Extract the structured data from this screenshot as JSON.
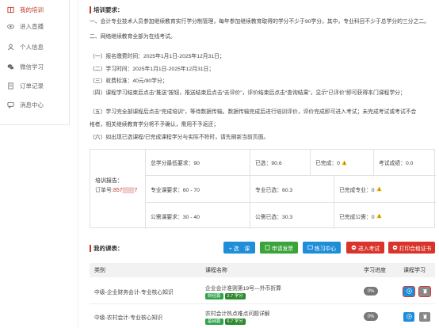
{
  "sidebar": {
    "items": [
      {
        "label": "我的培训",
        "icon": "book-icon",
        "active": true
      },
      {
        "label": "进入直播",
        "icon": "eye-icon",
        "active": false
      },
      {
        "label": "个人信息",
        "icon": "user-icon",
        "active": false
      },
      {
        "label": "微信学习",
        "icon": "wechat-icon",
        "active": false
      },
      {
        "label": "订单记录",
        "icon": "document-icon",
        "active": false
      },
      {
        "label": "消息中心",
        "icon": "message-icon",
        "active": false
      }
    ]
  },
  "requirements": {
    "title": "培训要求：",
    "lines": [
      "一、会计专业技术人员参加继续教育实行学分制管理，每年参加继续教育取得的学分不少于90学分，其中，专业科目不少于总学分的三分之二。",
      "二、网络继续教育全部为在线考试。",
      "（一）报名缴费时间：2025年1月1日-2025年12月31日；",
      "（二）学习时间：2025年1月1日-2025年12月31日；",
      "（三）收费标准：40元/90学分；",
      "（四）课程学习结束后点击“推送”按钮，推送结束后点击“去评价”，评价结束后点击“查询结果”，显示“已评价”即可获得本门课程学分；",
      "（五）学习完全部课程后点击“完成培训”，等待数据传输。数据传输完成后进行培训评价，评价完成即可进入考试；未完成考试或考试不合",
      "格者，相关继续教育学分将不予确认，需用不予返还；",
      "（六）如出现已选课程/已完成课程学分与实际不符时，请先刷新当前页面。"
    ]
  },
  "report": {
    "label": "培训报告：",
    "order_label": "订单号:",
    "order_value": "857▒▒▒7",
    "rows": [
      {
        "c1": "总学分最低要求：90",
        "c2": "已选：90.6",
        "c3": "已完成：0",
        "c4": "考试成绩：0.0"
      },
      {
        "c1": "专业课要求：60 - 70",
        "c2": "专业已选：60.3",
        "c3": "已完成专业：0"
      },
      {
        "c1": "公需课要求：30 - 40",
        "c2": "公需已选：30.3",
        "c3": "已完成公需：0"
      }
    ]
  },
  "courses": {
    "title": "我的课表：",
    "buttons": [
      {
        "label": "+ 选　课",
        "color": "#1f8ed8"
      },
      {
        "label": "申请发票",
        "color": "#3aa33a"
      },
      {
        "label": "练习中心",
        "color": "#1f8ed8"
      },
      {
        "label": "进入考试",
        "color": "#d9342b"
      },
      {
        "label": "打印合格证书",
        "color": "#d9342b"
      }
    ],
    "headers": [
      "类别",
      "课程名称",
      "学习进度",
      "课程学习"
    ],
    "rows": [
      {
        "category": "中级-企业财务会计-专业核心知识",
        "name": "企业会计准则第19号—外币折算",
        "tags": [
          {
            "text": "财经篇",
            "color": "#2fa34a"
          },
          {
            "text": "2.7 学分",
            "color": "#2b8a2b"
          }
        ],
        "progress": "0%"
      },
      {
        "category": "中级-农村会计-专业核心知识",
        "name": "农村会计热点难点问题详解",
        "tags": [
          {
            "text": "基础篇",
            "color": "#2fa34a"
          },
          {
            "text": "6.7 学分",
            "color": "#2b8a2b"
          }
        ],
        "progress": "0%"
      }
    ]
  }
}
